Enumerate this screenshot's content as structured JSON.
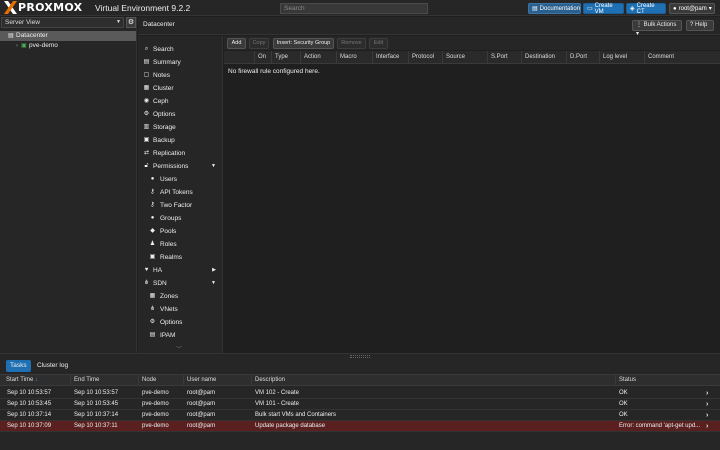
{
  "app": {
    "brand": "PROXMOX",
    "title": "Virtual Environment 9.2.2",
    "search_placeholder": "Search",
    "accent_color": "#e57000"
  },
  "toolbar": {
    "documentation": "Documentation",
    "create_vm": "Create VM",
    "create_ct": "Create CT",
    "user": "root@pam"
  },
  "tree": {
    "view": "Server View",
    "datacenter": "Datacenter",
    "node": "pve-demo"
  },
  "header": {
    "breadcrumb": "Datacenter",
    "bulk_actions": "Bulk Actions",
    "help": "Help"
  },
  "menu": {
    "items": [
      {
        "label": "Search",
        "icon": "search-icon"
      },
      {
        "label": "Summary",
        "icon": "summary-icon"
      },
      {
        "label": "Notes",
        "icon": "notes-icon"
      },
      {
        "label": "Cluster",
        "icon": "cluster-icon"
      },
      {
        "label": "Ceph",
        "icon": "ceph-icon"
      },
      {
        "label": "Options",
        "icon": "gear-icon"
      },
      {
        "label": "Storage",
        "icon": "storage-icon"
      },
      {
        "label": "Backup",
        "icon": "backup-icon"
      },
      {
        "label": "Replication",
        "icon": "replication-icon"
      },
      {
        "label": "Permissions",
        "icon": "unlock-icon"
      },
      {
        "label": "Users",
        "icon": "user-icon"
      },
      {
        "label": "API Tokens",
        "icon": "key-icon"
      },
      {
        "label": "Two Factor",
        "icon": "key-icon"
      },
      {
        "label": "Groups",
        "icon": "users-icon"
      },
      {
        "label": "Pools",
        "icon": "tags-icon"
      },
      {
        "label": "Roles",
        "icon": "male-icon"
      },
      {
        "label": "Realms",
        "icon": "address-book-icon"
      },
      {
        "label": "HA",
        "icon": "heartbeat-icon"
      },
      {
        "label": "SDN",
        "icon": "sdn-icon"
      },
      {
        "label": "Zones",
        "icon": "th-icon"
      },
      {
        "label": "VNets",
        "icon": "network-icon"
      },
      {
        "label": "Options",
        "icon": "gear-icon"
      },
      {
        "label": "IPAM",
        "icon": "ipam-icon"
      }
    ]
  },
  "firewall": {
    "buttons": {
      "add": "Add",
      "copy": "Copy",
      "insert": "Insert: Security Group",
      "remove": "Remove",
      "edit": "Edit"
    },
    "columns": [
      "On",
      "Type",
      "Action",
      "Macro",
      "Interface",
      "Protocol",
      "Source",
      "S.Port",
      "Destination",
      "D.Port",
      "Log level",
      "Comment"
    ],
    "empty_text": "No firewall rule configured here."
  },
  "tasks": {
    "tabs": [
      "Tasks",
      "Cluster log"
    ],
    "columns": [
      "Start Time",
      "End Time",
      "Node",
      "User name",
      "Description",
      "Status"
    ],
    "sort_indicator": "↓",
    "rows": [
      {
        "start": "Sep 10 10:53:57",
        "end": "Sep 10 10:53:57",
        "node": "pve-demo",
        "user": "root@pam",
        "desc": "VM 102 - Create",
        "status": "OK"
      },
      {
        "start": "Sep 10 10:53:45",
        "end": "Sep 10 10:53:45",
        "node": "pve-demo",
        "user": "root@pam",
        "desc": "VM 101 - Create",
        "status": "OK"
      },
      {
        "start": "Sep 10 10:37:14",
        "end": "Sep 10 10:37:14",
        "node": "pve-demo",
        "user": "root@pam",
        "desc": "Bulk start VMs and Containers",
        "status": "OK"
      },
      {
        "start": "Sep 10 10:37:09",
        "end": "Sep 10 10:37:11",
        "node": "pve-demo",
        "user": "root@pam",
        "desc": "Update package database",
        "status": "Error: command 'apt-get upd..."
      }
    ]
  }
}
